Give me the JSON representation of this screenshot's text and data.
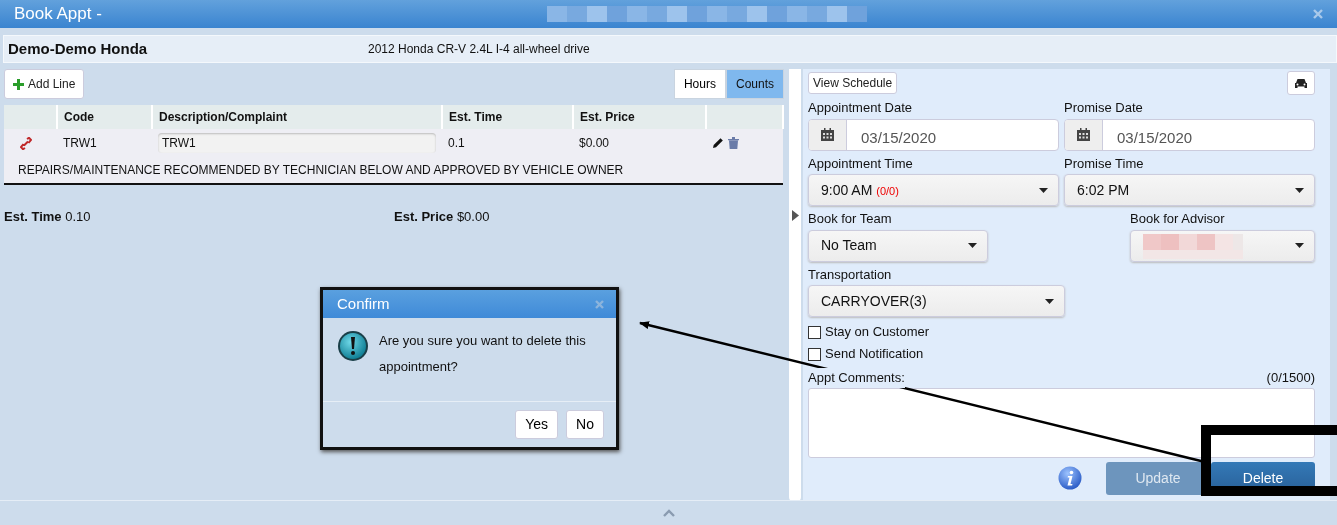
{
  "window": {
    "title": "Book Appt -"
  },
  "header": {
    "customer": "Demo-Demo Honda",
    "vehicle": "2012 Honda CR-V 2.4L I-4 all-wheel drive"
  },
  "toolbar": {
    "add_button": "Add Line",
    "view_toggle": [
      {
        "label": "Hours",
        "selected": false
      },
      {
        "label": "Counts",
        "selected": true
      }
    ]
  },
  "table": {
    "columns": [
      "Code",
      "Description/Complaint",
      "Est. Time",
      "Est. Price"
    ],
    "rows": [
      {
        "code": "TRW1",
        "description": "TRW1",
        "est_time": "0.1",
        "est_price": "$0.00"
      }
    ],
    "note": "REPAIRS/MAINTENANCE RECOMMENDED BY TECHNICIAN BELOW AND APPROVED BY VEHICLE OWNER"
  },
  "totals": [
    {
      "label": "Est. Time",
      "value": "0.10"
    },
    {
      "label": "Est. Price",
      "value": "$0.00"
    }
  ],
  "form": {
    "view_schedule": "View Schedule",
    "rows": [
      [
        {
          "kind": "date",
          "label": "Appointment Date",
          "value": "03/15/2020"
        },
        {
          "kind": "date",
          "label": "Promise Date",
          "value": "03/15/2020"
        }
      ],
      [
        {
          "kind": "select",
          "label": "Appointment Time",
          "value": "9:00 AM",
          "capacity": "(0/0)"
        },
        {
          "kind": "select",
          "label": "Promise Time",
          "value": "6:02 PM"
        }
      ],
      [
        {
          "kind": "select",
          "label": "Book for Team",
          "value": "No Team"
        },
        {
          "kind": "redacted",
          "label": "Book for Advisor"
        }
      ],
      [
        {
          "kind": "select",
          "label": "Transportation",
          "value": "CARRYOVER(3)"
        }
      ]
    ],
    "checkboxes": [
      {
        "label": "Stay on Customer",
        "checked": false
      },
      {
        "label": "Send Notification",
        "checked": false
      }
    ],
    "comments": {
      "label": "Appt Comments:",
      "counter": "(0/1500)"
    },
    "buttons": [
      {
        "label": "Update",
        "disabled": true
      },
      {
        "label": "Delete",
        "disabled": false
      }
    ]
  },
  "dialog": {
    "title": "Confirm",
    "message": "Are you sure you want to delete this appointment?",
    "buttons": [
      "Yes",
      "No"
    ]
  }
}
